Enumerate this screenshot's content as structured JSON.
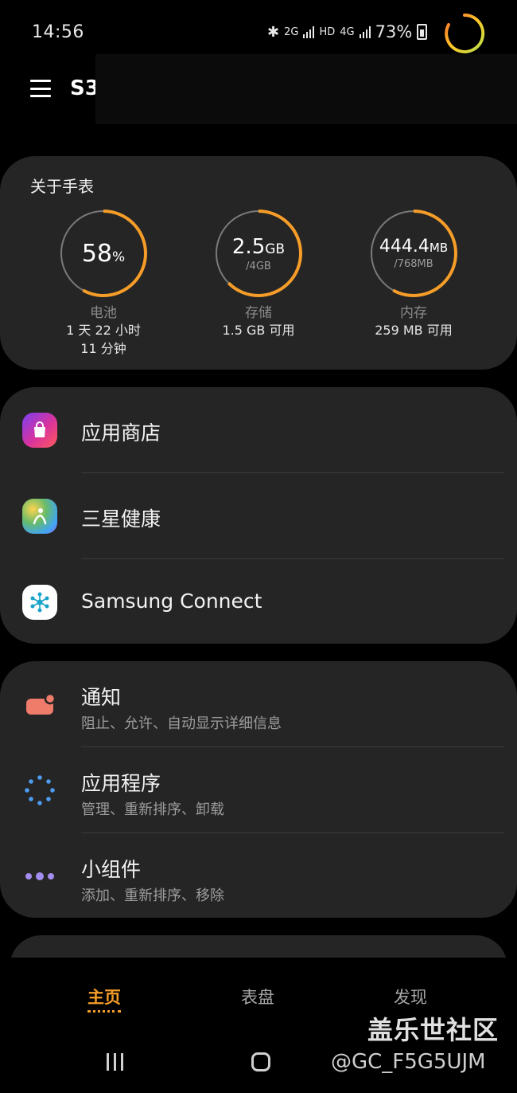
{
  "status_bar": {
    "time": "14:56",
    "network_2g": "2G",
    "hd": "HD",
    "network_4g": "4G",
    "battery_percent": "73%"
  },
  "app_bar": {
    "device_name": "S3"
  },
  "about_watch": {
    "title": "关于手表",
    "battery": {
      "value": "58",
      "unit": "%",
      "label": "电池",
      "detail_line1": "1 天 22 小时",
      "detail_line2": "11 分钟",
      "level": 0.58
    },
    "storage": {
      "value": "2.5",
      "unit": "GB",
      "total": "/4GB",
      "label": "存储",
      "detail": "1.5 GB 可用",
      "level": 0.625
    },
    "memory": {
      "value": "444.4",
      "unit": "MB",
      "total": "/768MB",
      "label": "内存",
      "detail": "259 MB 可用",
      "level": 0.58
    }
  },
  "apps_card": {
    "items": [
      {
        "label": "应用商店",
        "icon": "shopping-bag-icon"
      },
      {
        "label": "三星健康",
        "icon": "samsung-health-icon"
      },
      {
        "label": "Samsung Connect",
        "icon": "samsung-connect-icon"
      }
    ]
  },
  "settings_card": {
    "items": [
      {
        "label": "通知",
        "sub": "阻止、允许、自动显示详细信息",
        "icon": "notification-icon"
      },
      {
        "label": "应用程序",
        "sub": "管理、重新排序、卸载",
        "icon": "apps-dots-icon"
      },
      {
        "label": "小组件",
        "sub": "添加、重新排序、移除",
        "icon": "widgets-icon"
      }
    ]
  },
  "bottom_nav": {
    "tabs": [
      {
        "label": "主页",
        "active": true
      },
      {
        "label": "表盘",
        "active": false
      },
      {
        "label": "发现",
        "active": false
      }
    ]
  },
  "watermark": {
    "brand": "盖乐世社区",
    "user": "@GC_F5G5UJM"
  },
  "colors": {
    "accent": "#f59d28",
    "card": "#252525",
    "background": "#000000"
  }
}
